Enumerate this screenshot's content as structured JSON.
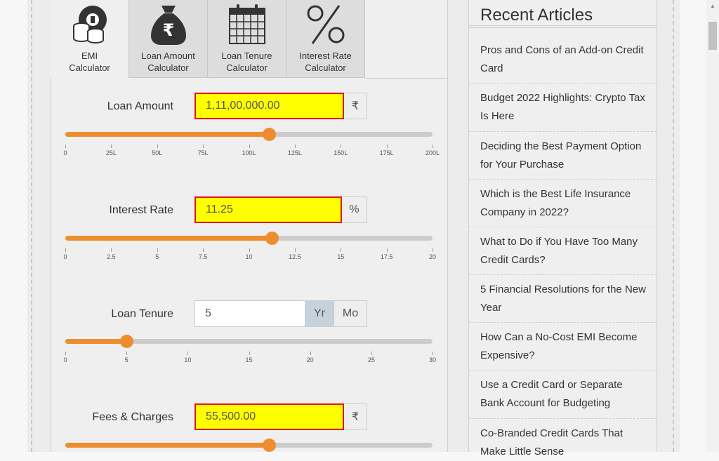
{
  "tabs": [
    {
      "label_line1": "EMI",
      "label_line2": "Calculator",
      "icon": "coins-stack-icon",
      "active": true
    },
    {
      "label_line1": "Loan Amount",
      "label_line2": "Calculator",
      "icon": "money-bag-rupee-icon",
      "active": false
    },
    {
      "label_line1": "Loan Tenure",
      "label_line2": "Calculator",
      "icon": "calendar-icon",
      "active": false
    },
    {
      "label_line1": "Interest Rate",
      "label_line2": "Calculator",
      "icon": "percent-icon",
      "active": false
    }
  ],
  "loan_amount": {
    "label": "Loan Amount",
    "value": "1,11,00,000.00",
    "unit": "₹",
    "slider_value": 111,
    "slider_max": 200,
    "ticks": [
      "0",
      "25L",
      "50L",
      "75L",
      "100L",
      "125L",
      "150L",
      "175L",
      "200L"
    ]
  },
  "interest_rate": {
    "label": "Interest Rate",
    "value": "11.25",
    "unit": "%",
    "slider_value": 11.25,
    "slider_max": 20,
    "ticks": [
      "0",
      "2.5",
      "5",
      "7.5",
      "10",
      "12.5",
      "15",
      "17.5",
      "20"
    ]
  },
  "loan_tenure": {
    "label": "Loan Tenure",
    "value": "5",
    "unit_year": "Yr",
    "unit_month": "Mo",
    "selected_unit": "Yr",
    "slider_value": 5,
    "slider_max": 30,
    "ticks": [
      "0",
      "5",
      "10",
      "15",
      "20",
      "25",
      "30"
    ]
  },
  "fees": {
    "label": "Fees & Charges",
    "value": "55,500.00",
    "unit": "₹",
    "slider_value": 55500,
    "slider_max": 100000
  },
  "sidebar": {
    "title": "Recent Articles",
    "articles": [
      "Pros and Cons of an Add-on Credit Card",
      "Budget 2022 Highlights: Crypto Tax Is Here",
      "Deciding the Best Payment Option for Your Purchase",
      "Which is the Best Life Insurance Company in 2022?",
      "What to Do if You Have Too Many Credit Cards?",
      "5 Financial Resolutions for the New Year",
      "How Can a No-Cost EMI Become Expensive?",
      "Use a Credit Card or Separate Bank Account for Budgeting",
      "Co-Branded Credit Cards That Make Little Sense"
    ]
  },
  "colors": {
    "accent": "#ee8d2d",
    "highlight": "#ffff00",
    "highlight_border": "#e2151b",
    "track": "#cccccc"
  }
}
